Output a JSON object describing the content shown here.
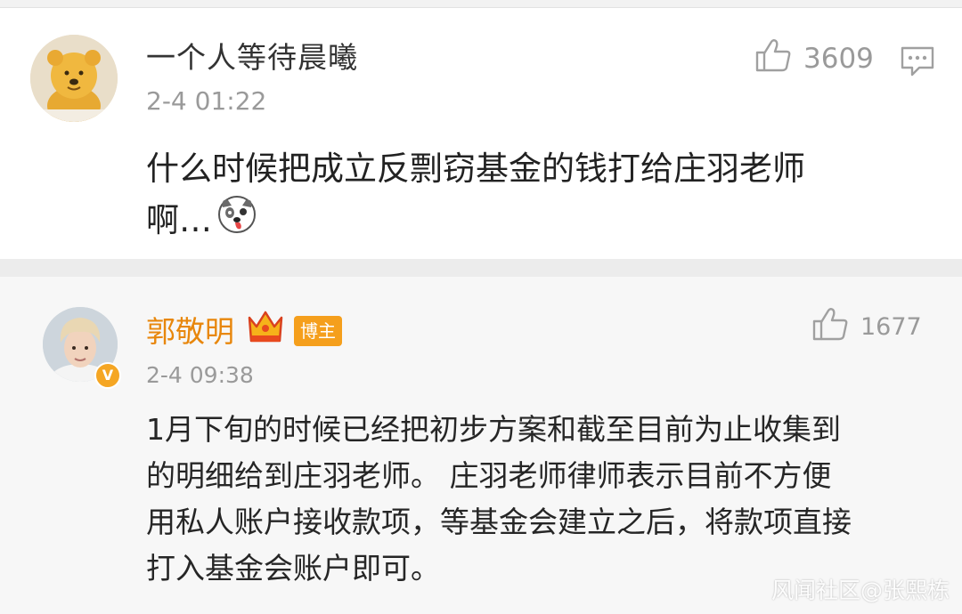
{
  "comments": [
    {
      "username": "一个人等待晨曦",
      "time": "2-4 01:22",
      "like_count": "3609",
      "text_lines": [
        "什么时候把成立反剽窃基金的钱打给庄羽老师",
        "啊…"
      ],
      "avatar_icon": "winnie-the-pooh-avatar",
      "emoji_icon": "dog-face-emoji"
    },
    {
      "username": "郭敬明",
      "badge": "博主",
      "time": "2-4 09:38",
      "like_count": "1677",
      "text_lines": [
        "1月下旬的时候已经把初步方案和截至目前为止收集到",
        "的明细给到庄羽老师。 庄羽老师律师表示目前不方便",
        "用私人账户接收款项，等基金会建立之后，将款项直接",
        "打入基金会账户即可。"
      ],
      "avatar_icon": "person-photo-avatar",
      "verified_icon": "verified-v-icon",
      "crown_icon": "crown-icon",
      "username_color": "#e8870c",
      "badge_color": "#f59f1c"
    }
  ],
  "watermark": "风闻社区@张熙栋"
}
